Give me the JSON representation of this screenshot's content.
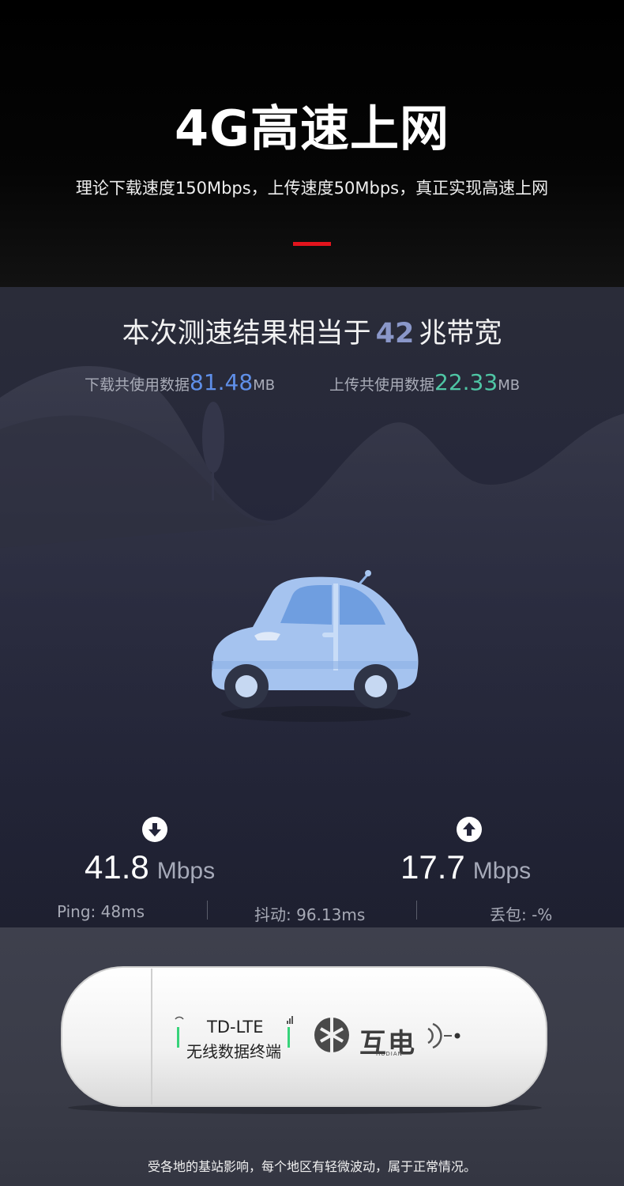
{
  "header": {
    "title": "4G高速上网",
    "subtitle": "理论下载速度150Mbps，上传速度50Mbps，真正实现高速上网",
    "accent_color": "#e3141d"
  },
  "speed_test": {
    "result_prefix": "本次测速结果相当于",
    "result_value": "42",
    "result_suffix": "兆带宽",
    "download_usage": {
      "label": "下载共使用数据",
      "value": "81.48",
      "unit": "MB",
      "color": "#5f8fe8"
    },
    "upload_usage": {
      "label": "上传共使用数据",
      "value": "22.33",
      "unit": "MB",
      "color": "#4fc6a5"
    },
    "download_icon": "arrow-down-circle-icon",
    "upload_icon": "arrow-up-circle-icon",
    "download_rate": {
      "value": "41.8",
      "unit": "Mbps"
    },
    "upload_rate": {
      "value": "17.7",
      "unit": "Mbps"
    },
    "ping": "Ping:  48ms",
    "jitter": "抖动:  96.13ms",
    "packet_loss": "丢包:  -%"
  },
  "product": {
    "lte_label": "TD-LTE",
    "lte_cn": "无线数据终端",
    "brand": "互电",
    "brand_en": "HUDIAN",
    "disclaimer": "受各地的基站影响，每个地区有轻微波动，属于正常情况。"
  }
}
